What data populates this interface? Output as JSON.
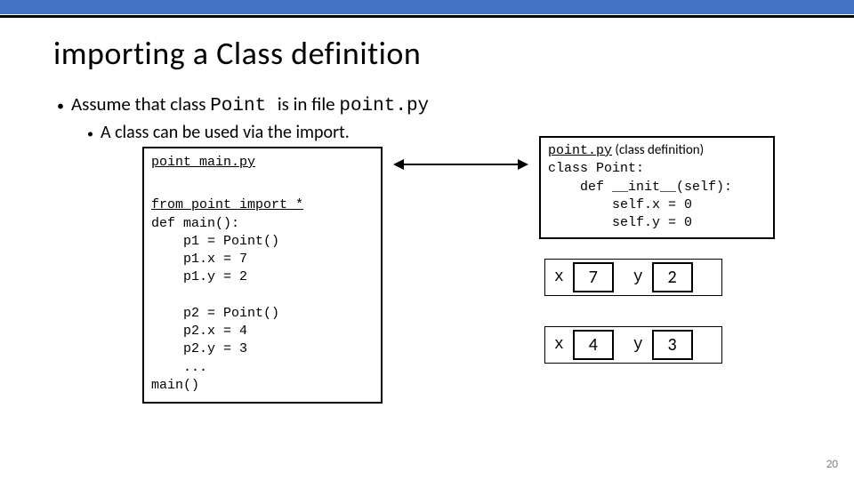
{
  "top_bar_color": "#4472C4",
  "title": "importing a Class definition",
  "bullet1_prefix": "Assume that class ",
  "bullet1_mono1": "Point ",
  "bullet1_mid": "is in file ",
  "bullet1_mono2": "point.py",
  "bullet2": "A class can be used via the import.",
  "left_box": {
    "filename": "point_main.py",
    "import_line": "from point import *",
    "l2": "def main():",
    "l3": "    p1 = Point()",
    "l4": "    p1.x = 7",
    "l5": "    p1.y = 2",
    "blank": " ",
    "l6": "    p2 = Point()",
    "l7": "    p2.x = 4",
    "l8": "    p2.y = 3",
    "l9": "    ...",
    "l10": "main()"
  },
  "right_box": {
    "filename": "point.py",
    "class_def_suffix": " (class definition)",
    "r1": "class Point:",
    "r2": "    def __init__(self):",
    "r3": "        self.x = 0",
    "r4": "        self.y = 0"
  },
  "obj1": {
    "xlabel": "x",
    "xval": "7",
    "ylabel": "y",
    "yval": "2"
  },
  "obj2": {
    "xlabel": "x",
    "xval": "4",
    "ylabel": "y",
    "yval": "3"
  },
  "page_number": "20"
}
